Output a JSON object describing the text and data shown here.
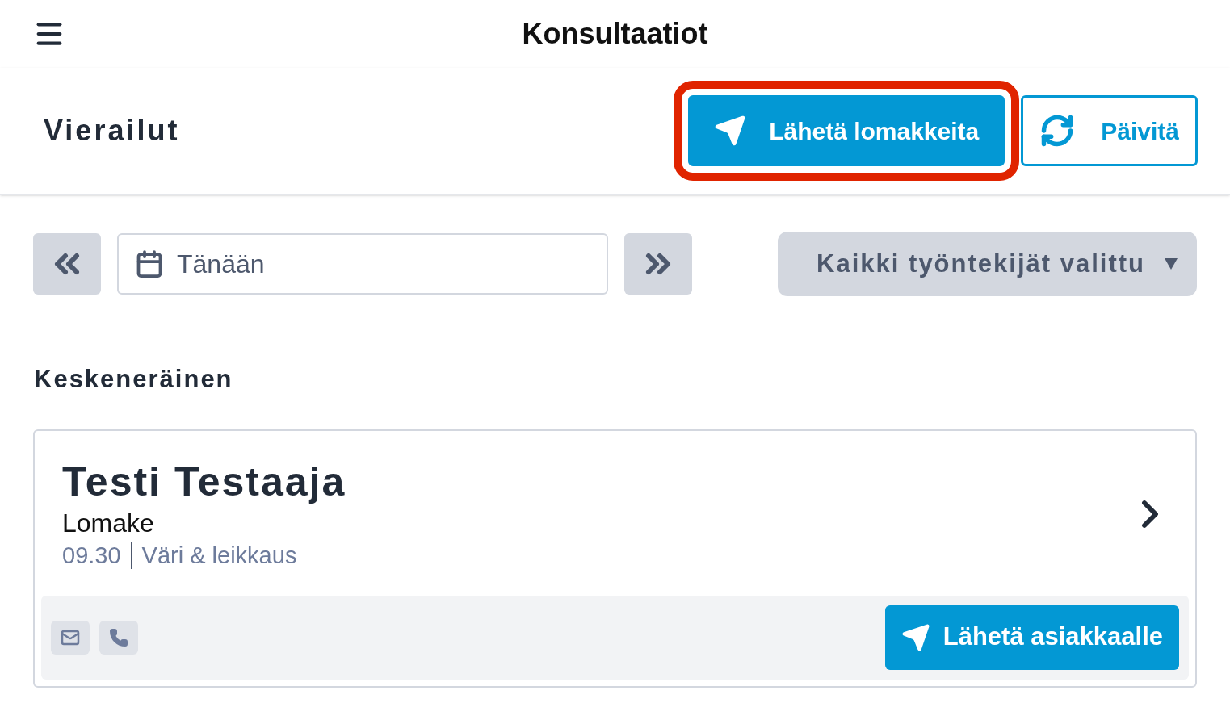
{
  "header": {
    "title": "Konsultaatiot"
  },
  "toolbar": {
    "title": "Vierailut",
    "buttons": [
      {
        "kind": "primary",
        "label": "Lähetä lomakkeita",
        "highlighted": true
      },
      {
        "kind": "outline",
        "label": "Päivitä",
        "highlighted": false
      }
    ]
  },
  "date_nav": {
    "date": "Tänään",
    "staff_filter": "Kaikki työntekijät valittu"
  },
  "section": {
    "title": "Keskeneräinen"
  },
  "visits": [
    {
      "name": "Testi Testaaja",
      "form": "Lomake",
      "time": "09.30",
      "service": "Väri & leikkaus",
      "action": "Lähetä asiakkaalle"
    }
  ]
}
